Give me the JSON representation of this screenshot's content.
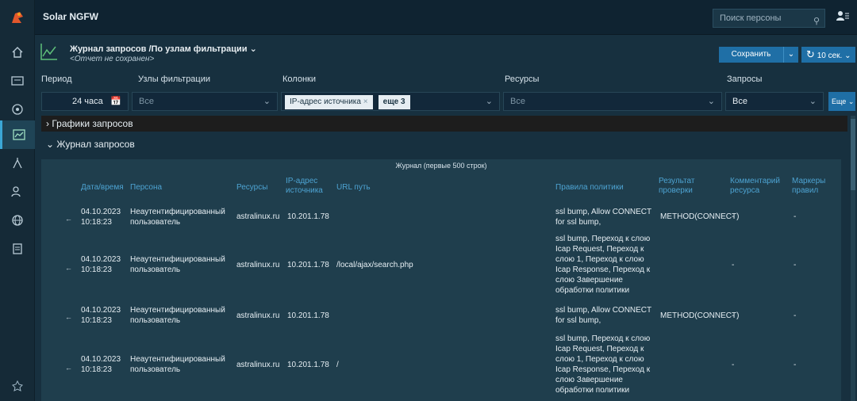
{
  "app": {
    "title": "Solar NGFW"
  },
  "search": {
    "placeholder": "Поиск персоны"
  },
  "report": {
    "title": "Журнал запросов /По узлам фильтрации",
    "subtitle": "<Отчет не сохранен>",
    "save_label": "Сохранить",
    "refresh_label": "10 сек."
  },
  "filters": {
    "period_label": "Период",
    "period_value": "24 часа",
    "nodes_label": "Узлы фильтрации",
    "nodes_value": "Все",
    "columns_label": "Колонки",
    "columns_chip": "IP-адрес источника",
    "columns_more": "еще 3",
    "resources_label": "Ресурсы",
    "resources_value": "Все",
    "requests_label": "Запросы",
    "requests_value": "Все",
    "more_label": "Еще"
  },
  "sections": {
    "charts": "Графики запросов",
    "journal": "Журнал запросов"
  },
  "table": {
    "caption": "Журнал (первые 500 строк)",
    "headers": {
      "datetime": "Дата/время",
      "person": "Персона",
      "resources": "Ресурсы",
      "ip": "IP-адрес источника",
      "url": "URL путь",
      "rules": "Правила политики",
      "result": "Результат проверки",
      "comment": "Комментарий ресурса",
      "markers": "Маркеры правил"
    },
    "rows": [
      {
        "date": "04.10.2023",
        "time": "10:18:23",
        "person": "Неаутентифицированный пользователь",
        "resource": "astralinux.ru",
        "ip": "10.201.1.78",
        "url": "",
        "rules": "ssl bump, Allow CONNECT for ssl bump,",
        "result": "METHOD(CONNECT)",
        "comment": "-",
        "markers": "-"
      },
      {
        "date": "04.10.2023",
        "time": "10:18:23",
        "person": "Неаутентифицированный пользователь",
        "resource": "astralinux.ru",
        "ip": "10.201.1.78",
        "url": "/local/ajax/search.php",
        "rules": "ssl bump, Переход к слою Icap Request, Переход к слою 1, Переход к слою Icap Response, Переход к слою Завершение обработки политики",
        "result": "",
        "comment": "-",
        "markers": "-"
      },
      {
        "date": "04.10.2023",
        "time": "10:18:23",
        "person": "Неаутентифицированный пользователь",
        "resource": "astralinux.ru",
        "ip": "10.201.1.78",
        "url": "",
        "rules": "ssl bump, Allow CONNECT for ssl bump,",
        "result": "METHOD(CONNECT)",
        "comment": "-",
        "markers": "-"
      },
      {
        "date": "04.10.2023",
        "time": "10:18:23",
        "person": "Неаутентифицированный пользователь",
        "resource": "astralinux.ru",
        "ip": "10.201.1.78",
        "url": "/",
        "rules": "ssl bump, Переход к слою Icap Request, Переход к слою 1, Переход к слою Icap Response, Переход к слою Завершение обработки политики",
        "result": "",
        "comment": "-",
        "markers": "-"
      }
    ]
  },
  "colors": {
    "accent": "#1f6fa6",
    "header_text": "#4da3d2",
    "background": "#17303f"
  }
}
